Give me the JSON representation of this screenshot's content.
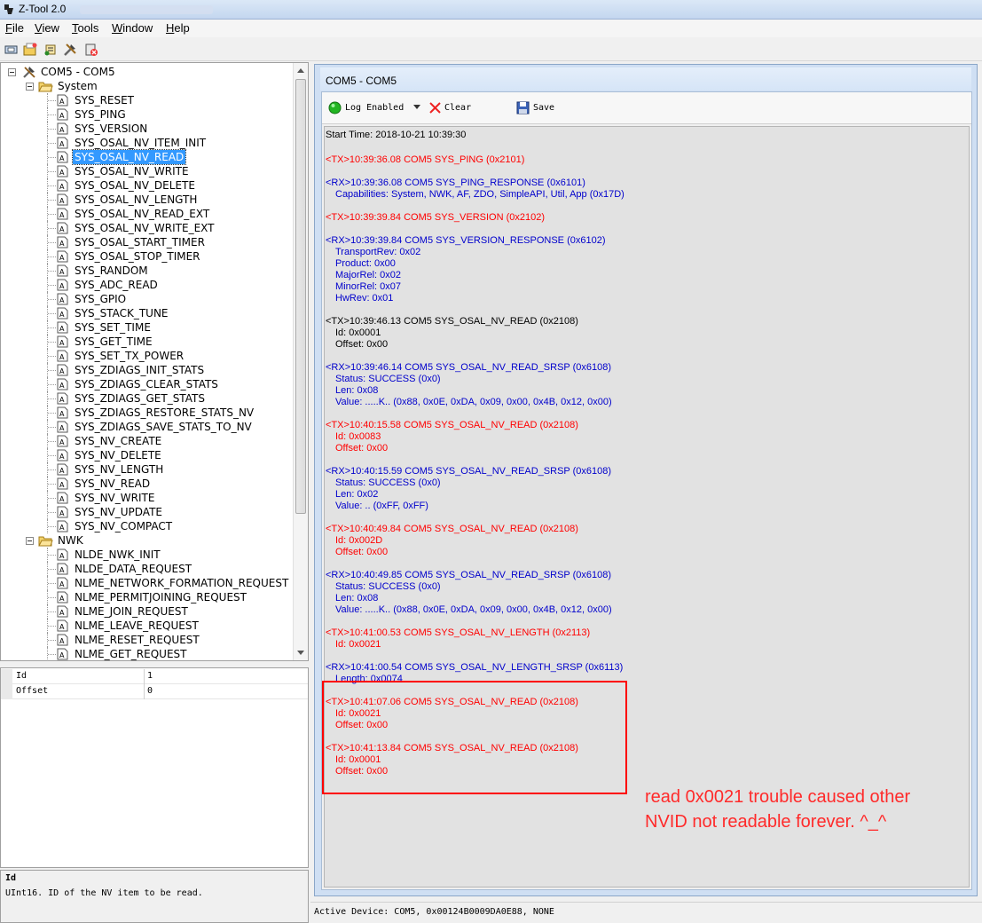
{
  "window": {
    "title": "Z-Tool 2.0"
  },
  "menu": [
    {
      "label": "File",
      "mnemonic": "F",
      "rest": "ile"
    },
    {
      "label": "View",
      "mnemonic": "V",
      "rest": "iew"
    },
    {
      "label": "Tools",
      "mnemonic": "T",
      "rest": "ools"
    },
    {
      "label": "Window",
      "mnemonic": "W",
      "rest": "indow"
    },
    {
      "label": "Help",
      "mnemonic": "H",
      "rest": "elp"
    }
  ],
  "tree": {
    "root": "COM5 - COM5",
    "groups": [
      {
        "label": "System",
        "items": [
          "SYS_RESET",
          "SYS_PING",
          "SYS_VERSION",
          "SYS_OSAL_NV_ITEM_INIT",
          "SYS_OSAL_NV_READ",
          "SYS_OSAL_NV_WRITE",
          "SYS_OSAL_NV_DELETE",
          "SYS_OSAL_NV_LENGTH",
          "SYS_OSAL_NV_READ_EXT",
          "SYS_OSAL_NV_WRITE_EXT",
          "SYS_OSAL_START_TIMER",
          "SYS_OSAL_STOP_TIMER",
          "SYS_RANDOM",
          "SYS_ADC_READ",
          "SYS_GPIO",
          "SYS_STACK_TUNE",
          "SYS_SET_TIME",
          "SYS_GET_TIME",
          "SYS_SET_TX_POWER",
          "SYS_ZDIAGS_INIT_STATS",
          "SYS_ZDIAGS_CLEAR_STATS",
          "SYS_ZDIAGS_GET_STATS",
          "SYS_ZDIAGS_RESTORE_STATS_NV",
          "SYS_ZDIAGS_SAVE_STATS_TO_NV",
          "SYS_NV_CREATE",
          "SYS_NV_DELETE",
          "SYS_NV_LENGTH",
          "SYS_NV_READ",
          "SYS_NV_WRITE",
          "SYS_NV_UPDATE",
          "SYS_NV_COMPACT"
        ]
      },
      {
        "label": "NWK",
        "items": [
          "NLDE_NWK_INIT",
          "NLDE_DATA_REQUEST",
          "NLME_NETWORK_FORMATION_REQUEST",
          "NLME_PERMITJOINING_REQUEST",
          "NLME_JOIN_REQUEST",
          "NLME_LEAVE_REQUEST",
          "NLME_RESET_REQUEST",
          "NLME_GET_REQUEST"
        ]
      }
    ],
    "selected": "SYS_OSAL_NV_READ"
  },
  "properties": [
    {
      "key": "Id",
      "value": "1"
    },
    {
      "key": "Offset",
      "value": "0"
    }
  ],
  "description": {
    "heading": "Id",
    "text": "UInt16.  ID of the NV item to be read."
  },
  "document": {
    "title": "COM5 - COM5",
    "toolbar": {
      "log_label": "Log Enabled",
      "clear_label": "Clear",
      "save_label": "Save"
    },
    "start_time": "Start Time: 2018-10-21 10:39:30",
    "entries": [
      {
        "color": "red",
        "lines": [
          "<TX>10:39:36.08 COM5 SYS_PING (0x2101)"
        ]
      },
      {
        "color": "blue",
        "lines": [
          "<RX>10:39:36.08 COM5 SYS_PING_RESPONSE (0x6101)",
          "Capabilities: System, NWK, AF, ZDO, SimpleAPI, Util, App (0x17D)"
        ]
      },
      {
        "color": "red",
        "lines": [
          "<TX>10:39:39.84 COM5 SYS_VERSION (0x2102)"
        ]
      },
      {
        "color": "blue",
        "lines": [
          "<RX>10:39:39.84 COM5 SYS_VERSION_RESPONSE (0x6102)",
          "TransportRev: 0x02",
          "Product: 0x00",
          "MajorRel: 0x02",
          "MinorRel: 0x07",
          "HwRev: 0x01"
        ]
      },
      {
        "color": "black",
        "lines": [
          "<TX>10:39:46.13 COM5 SYS_OSAL_NV_READ (0x2108)",
          "Id: 0x0001",
          "Offset: 0x00"
        ]
      },
      {
        "color": "blue",
        "lines": [
          "<RX>10:39:46.14 COM5 SYS_OSAL_NV_READ_SRSP (0x6108)",
          "Status: SUCCESS (0x0)",
          "Len: 0x08",
          "Value: .....K.. (0x88, 0x0E, 0xDA, 0x09, 0x00, 0x4B, 0x12, 0x00)"
        ]
      },
      {
        "color": "red",
        "lines": [
          "<TX>10:40:15.58 COM5 SYS_OSAL_NV_READ (0x2108)",
          "Id: 0x0083",
          "Offset: 0x00"
        ]
      },
      {
        "color": "blue",
        "lines": [
          "<RX>10:40:15.59 COM5 SYS_OSAL_NV_READ_SRSP (0x6108)",
          "Status: SUCCESS (0x0)",
          "Len: 0x02",
          "Value: .. (0xFF, 0xFF)"
        ]
      },
      {
        "color": "red",
        "lines": [
          "<TX>10:40:49.84 COM5 SYS_OSAL_NV_READ (0x2108)",
          "Id: 0x002D",
          "Offset: 0x00"
        ]
      },
      {
        "color": "blue",
        "lines": [
          "<RX>10:40:49.85 COM5 SYS_OSAL_NV_READ_SRSP (0x6108)",
          "Status: SUCCESS (0x0)",
          "Len: 0x08",
          "Value: .....K.. (0x88, 0x0E, 0xDA, 0x09, 0x00, 0x4B, 0x12, 0x00)"
        ]
      },
      {
        "color": "red",
        "lines": [
          "<TX>10:41:00.53 COM5 SYS_OSAL_NV_LENGTH (0x2113)",
          "Id: 0x0021"
        ]
      },
      {
        "color": "blue",
        "lines": [
          "<RX>10:41:00.54 COM5 SYS_OSAL_NV_LENGTH_SRSP (0x6113)",
          "Length: 0x0074"
        ]
      },
      {
        "color": "red",
        "lines": [
          "<TX>10:41:07.06 COM5 SYS_OSAL_NV_READ (0x2108)",
          "Id: 0x0021",
          "Offset: 0x00"
        ]
      },
      {
        "color": "red",
        "lines": [
          "<TX>10:41:13.84 COM5 SYS_OSAL_NV_READ (0x2108)",
          "Id: 0x0001",
          "Offset: 0x00"
        ]
      }
    ]
  },
  "annotation": {
    "line1": "read 0x0021 trouble caused other",
    "line2": "NVID not readable forever. ^_^"
  },
  "status": {
    "text": "Active Device: COM5, 0x00124B0009DA0E88, NONE"
  },
  "colors": {
    "tx": "#ff0000",
    "rx": "#0000cc",
    "selection": "#3399ff",
    "annotation": "#ff2a2a"
  }
}
